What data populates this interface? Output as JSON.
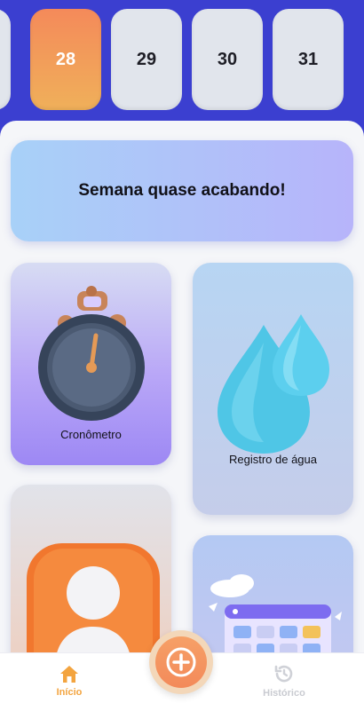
{
  "dates": [
    "28",
    "29",
    "30",
    "31"
  ],
  "active_date": "28",
  "banner": {
    "text": "Semana quase acabando!"
  },
  "cards": {
    "stopwatch": {
      "label": "Cronômetro",
      "icon": "stopwatch-icon"
    },
    "water": {
      "label": "Registro de água",
      "icon": "water-drops-icon"
    },
    "profile": {
      "icon": "user-profile-icon"
    },
    "calendar": {
      "icon": "calendar-icon"
    }
  },
  "nav": {
    "home_label": "Início",
    "history_label": "Histórico",
    "fab_icon": "plus-icon"
  },
  "colors": {
    "header_blue": "#3b3fd0",
    "accent_orange": "#f3a43f",
    "active_date": "#f48a5a"
  }
}
